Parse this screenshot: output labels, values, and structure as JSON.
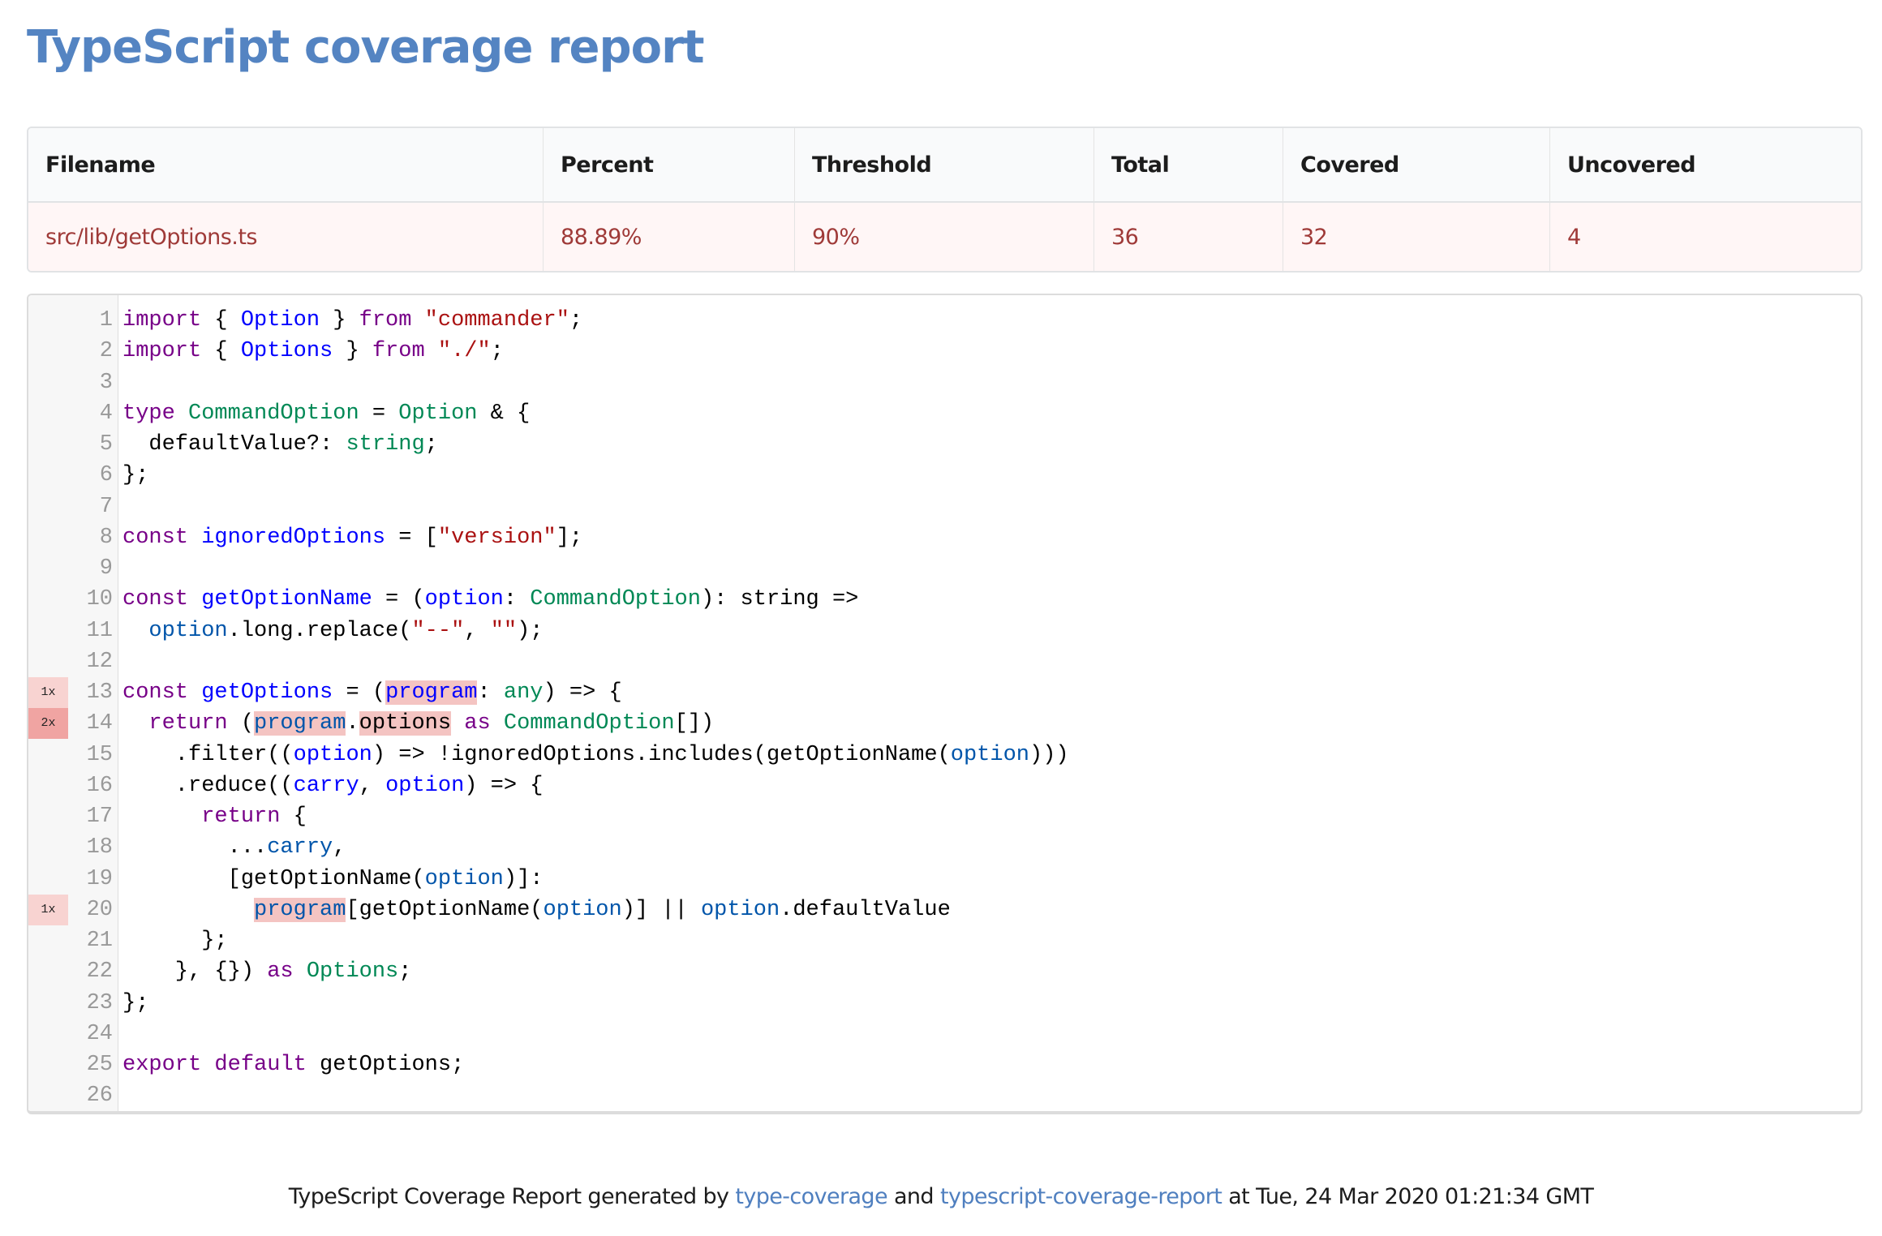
{
  "page": {
    "title": "TypeScript coverage report"
  },
  "summary": {
    "columns": [
      "Filename",
      "Percent",
      "Threshold",
      "Total",
      "Covered",
      "Uncovered"
    ],
    "row": {
      "filename": "src/lib/getOptions.ts",
      "percent": "88.89%",
      "threshold": "90%",
      "total": "36",
      "covered": "32",
      "uncovered": "4"
    }
  },
  "colors": {
    "title": "#5484c2",
    "keyword": "#770088",
    "definition": "#0000ff",
    "variable": "#0055aa",
    "type": "#008855",
    "string": "#aa1111",
    "uncovered_highlight": "#f4c4c2",
    "negative_row_bg": "#fff6f6",
    "negative_row_text": "#9f3a38"
  },
  "code": {
    "lines": [
      {
        "n": "1",
        "cov": "",
        "tokens": [
          [
            "kw",
            "import"
          ],
          [
            "op",
            " { "
          ],
          [
            "def",
            "Option"
          ],
          [
            "op",
            " } "
          ],
          [
            "kw",
            "from"
          ],
          [
            "op",
            " "
          ],
          [
            "str",
            "\"commander\""
          ],
          [
            "op",
            ";"
          ]
        ]
      },
      {
        "n": "2",
        "cov": "",
        "tokens": [
          [
            "kw",
            "import"
          ],
          [
            "op",
            " { "
          ],
          [
            "def",
            "Options"
          ],
          [
            "op",
            " } "
          ],
          [
            "kw",
            "from"
          ],
          [
            "op",
            " "
          ],
          [
            "str",
            "\"./\""
          ],
          [
            "op",
            ";"
          ]
        ]
      },
      {
        "n": "3",
        "cov": "",
        "tokens": []
      },
      {
        "n": "4",
        "cov": "",
        "tokens": [
          [
            "kw",
            "type"
          ],
          [
            "op",
            " "
          ],
          [
            "type",
            "CommandOption"
          ],
          [
            "op",
            " = "
          ],
          [
            "type",
            "Option"
          ],
          [
            "op",
            " & {"
          ]
        ]
      },
      {
        "n": "5",
        "cov": "",
        "tokens": [
          [
            "op",
            "  defaultValue?: "
          ],
          [
            "type",
            "string"
          ],
          [
            "op",
            ";"
          ]
        ]
      },
      {
        "n": "6",
        "cov": "",
        "tokens": [
          [
            "op",
            "};"
          ]
        ]
      },
      {
        "n": "7",
        "cov": "",
        "tokens": []
      },
      {
        "n": "8",
        "cov": "",
        "tokens": [
          [
            "kw",
            "const"
          ],
          [
            "op",
            " "
          ],
          [
            "def",
            "ignoredOptions"
          ],
          [
            "op",
            " = ["
          ],
          [
            "str",
            "\"version\""
          ],
          [
            "op",
            "];"
          ]
        ]
      },
      {
        "n": "9",
        "cov": "",
        "tokens": []
      },
      {
        "n": "10",
        "cov": "",
        "tokens": [
          [
            "kw",
            "const"
          ],
          [
            "op",
            " "
          ],
          [
            "def",
            "getOptionName"
          ],
          [
            "op",
            " = ("
          ],
          [
            "def",
            "option"
          ],
          [
            "op",
            ": "
          ],
          [
            "type",
            "CommandOption"
          ],
          [
            "op",
            "): string =>"
          ]
        ]
      },
      {
        "n": "11",
        "cov": "",
        "tokens": [
          [
            "op",
            "  "
          ],
          [
            "var2",
            "option"
          ],
          [
            "op",
            ".long.replace("
          ],
          [
            "str",
            "\"--\""
          ],
          [
            "op",
            ", "
          ],
          [
            "str",
            "\"\""
          ],
          [
            "op",
            ");"
          ]
        ]
      },
      {
        "n": "12",
        "cov": "",
        "tokens": []
      },
      {
        "n": "13",
        "cov": "1x",
        "tokens": [
          [
            "kw",
            "const"
          ],
          [
            "op",
            " "
          ],
          [
            "def",
            "getOptions"
          ],
          [
            "op",
            " = ("
          ],
          [
            "def hl",
            "program"
          ],
          [
            "op",
            ": "
          ],
          [
            "type",
            "any"
          ],
          [
            "op",
            ") => {"
          ]
        ]
      },
      {
        "n": "14",
        "cov": "2x",
        "tokens": [
          [
            "op",
            "  "
          ],
          [
            "kw",
            "return"
          ],
          [
            "op",
            " ("
          ],
          [
            "var2 hl",
            "program"
          ],
          [
            "op",
            "."
          ],
          [
            "op hl",
            "options"
          ],
          [
            "op",
            " "
          ],
          [
            "kw",
            "as"
          ],
          [
            "op",
            " "
          ],
          [
            "type",
            "CommandOption"
          ],
          [
            "op",
            "[])"
          ]
        ]
      },
      {
        "n": "15",
        "cov": "",
        "tokens": [
          [
            "op",
            "    .filter(("
          ],
          [
            "def",
            "option"
          ],
          [
            "op",
            ") => !ignoredOptions.includes(getOptionName("
          ],
          [
            "var2",
            "option"
          ],
          [
            "op",
            ")))"
          ]
        ]
      },
      {
        "n": "16",
        "cov": "",
        "tokens": [
          [
            "op",
            "    .reduce(("
          ],
          [
            "def",
            "carry"
          ],
          [
            "op",
            ", "
          ],
          [
            "def",
            "option"
          ],
          [
            "op",
            ") => {"
          ]
        ]
      },
      {
        "n": "17",
        "cov": "",
        "tokens": [
          [
            "op",
            "      "
          ],
          [
            "kw",
            "return"
          ],
          [
            "op",
            " {"
          ]
        ]
      },
      {
        "n": "18",
        "cov": "",
        "tokens": [
          [
            "op",
            "        ..."
          ],
          [
            "var2",
            "carry"
          ],
          [
            "op",
            ","
          ]
        ]
      },
      {
        "n": "19",
        "cov": "",
        "tokens": [
          [
            "op",
            "        [getOptionName("
          ],
          [
            "var2",
            "option"
          ],
          [
            "op",
            ")]:"
          ]
        ]
      },
      {
        "n": "20",
        "cov": "1x",
        "tokens": [
          [
            "op",
            "          "
          ],
          [
            "var2 hl",
            "program"
          ],
          [
            "op",
            "[getOptionName("
          ],
          [
            "var2",
            "option"
          ],
          [
            "op",
            ")] || "
          ],
          [
            "var2",
            "option"
          ],
          [
            "op",
            ".defaultValue"
          ]
        ]
      },
      {
        "n": "21",
        "cov": "",
        "tokens": [
          [
            "op",
            "      };"
          ]
        ]
      },
      {
        "n": "22",
        "cov": "",
        "tokens": [
          [
            "op",
            "    }, {}) "
          ],
          [
            "kw",
            "as"
          ],
          [
            "op",
            " "
          ],
          [
            "type",
            "Options"
          ],
          [
            "op",
            ";"
          ]
        ]
      },
      {
        "n": "23",
        "cov": "",
        "tokens": [
          [
            "op",
            "};"
          ]
        ]
      },
      {
        "n": "24",
        "cov": "",
        "tokens": []
      },
      {
        "n": "25",
        "cov": "",
        "tokens": [
          [
            "kw",
            "export"
          ],
          [
            "op",
            " "
          ],
          [
            "kw",
            "default"
          ],
          [
            "op",
            " getOptions;"
          ]
        ]
      },
      {
        "n": "26",
        "cov": "",
        "tokens": []
      }
    ]
  },
  "footer": {
    "prefix": "TypeScript Coverage Report generated by ",
    "link1": "type-coverage",
    "middle": " and ",
    "link2": "typescript-coverage-report",
    "suffix": " at Tue, 24 Mar 2020 01:21:34 GMT"
  }
}
